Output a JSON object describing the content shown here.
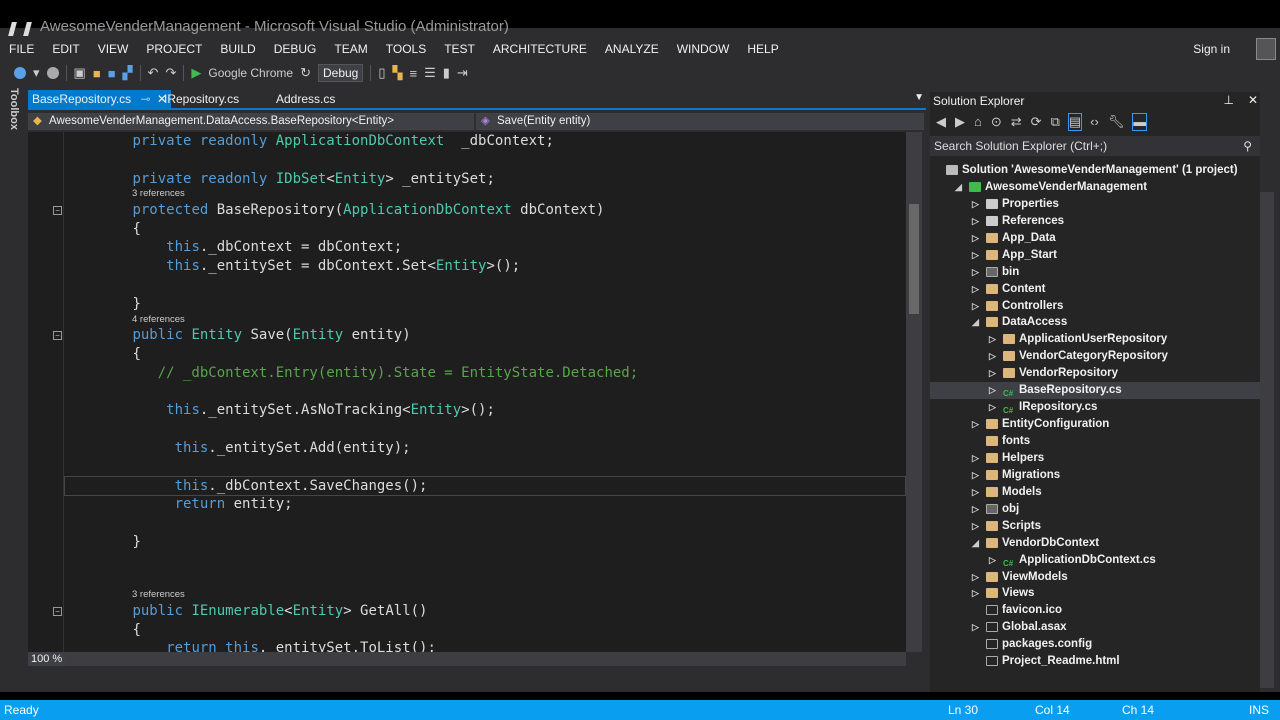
{
  "window": {
    "title": "AwesomeVenderManagement - Microsoft Visual Studio (Administrator)",
    "sign_in": "Sign in"
  },
  "menu": [
    "FILE",
    "EDIT",
    "VIEW",
    "PROJECT",
    "BUILD",
    "DEBUG",
    "TEAM",
    "TOOLS",
    "TEST",
    "ARCHITECTURE",
    "ANALYZE",
    "WINDOW",
    "HELP"
  ],
  "toolbar": {
    "browser": "Google Chrome",
    "config": "Debug"
  },
  "toolbox_label": "Toolbox",
  "tabs": [
    {
      "label": "BaseRepository.cs",
      "active": true
    },
    {
      "label": "IRepository.cs"
    },
    {
      "label": "Address.cs"
    }
  ],
  "navbar": {
    "type": "AwesomeVenderManagement.DataAccess.BaseRepository<Entity>",
    "member": "Save(Entity entity)"
  },
  "code": [
    {
      "i": 8,
      "t": [
        [
          "kw",
          "private readonly "
        ],
        [
          "ty",
          "ApplicationDbContext"
        ],
        [
          "",
          "  _dbContext;"
        ]
      ]
    },
    {
      "i": 0,
      "t": []
    },
    {
      "i": 8,
      "t": [
        [
          "kw",
          "private readonly "
        ],
        [
          "ty",
          "IDbSet"
        ],
        [
          "",
          "<"
        ],
        [
          "ty",
          "Entity"
        ],
        [
          "",
          "> _entitySet;"
        ]
      ]
    },
    {
      "ref": "3 references"
    },
    {
      "i": 8,
      "fold": true,
      "t": [
        [
          "kw",
          "protected "
        ],
        [
          "",
          "BaseRepository("
        ],
        [
          "ty",
          "ApplicationDbContext"
        ],
        [
          "",
          " dbContext)"
        ]
      ]
    },
    {
      "i": 8,
      "t": [
        [
          "",
          "{"
        ]
      ]
    },
    {
      "i": 12,
      "t": [
        [
          "kw",
          "this"
        ],
        [
          "",
          "._dbContext = dbContext;"
        ]
      ]
    },
    {
      "i": 12,
      "t": [
        [
          "kw",
          "this"
        ],
        [
          "",
          "._entitySet = dbContext.Set<"
        ],
        [
          "ty",
          "Entity"
        ],
        [
          "",
          ">();"
        ]
      ]
    },
    {
      "i": 0,
      "t": []
    },
    {
      "i": 8,
      "t": [
        [
          "",
          "}"
        ]
      ]
    },
    {
      "ref": "4 references"
    },
    {
      "i": 8,
      "fold": true,
      "t": [
        [
          "kw",
          "public "
        ],
        [
          "ty",
          "Entity"
        ],
        [
          "",
          " Save("
        ],
        [
          "ty",
          "Entity"
        ],
        [
          "",
          " entity)"
        ]
      ]
    },
    {
      "i": 8,
      "t": [
        [
          "",
          "{"
        ]
      ]
    },
    {
      "i": 11,
      "t": [
        [
          "cm",
          "// _dbContext.Entry(entity).State = EntityState.Detached;"
        ]
      ]
    },
    {
      "i": 0,
      "t": []
    },
    {
      "i": 12,
      "t": [
        [
          "kw",
          "this"
        ],
        [
          "",
          "._entitySet.AsNoTracking<"
        ],
        [
          "ty",
          "Entity"
        ],
        [
          "",
          ">();"
        ]
      ]
    },
    {
      "i": 0,
      "t": []
    },
    {
      "i": 13,
      "t": [
        [
          "kw",
          "this"
        ],
        [
          "",
          "._entitySet.Add(entity);"
        ]
      ]
    },
    {
      "i": 0,
      "t": []
    },
    {
      "i": 13,
      "cur": true,
      "t": [
        [
          "kw",
          "this"
        ],
        [
          "",
          "._dbContext.SaveChanges();"
        ]
      ]
    },
    {
      "i": 13,
      "t": [
        [
          "kw",
          "return"
        ],
        [
          "",
          " entity;"
        ]
      ]
    },
    {
      "i": 0,
      "t": []
    },
    {
      "i": 8,
      "t": [
        [
          "",
          "}"
        ]
      ]
    },
    {
      "i": 0,
      "t": []
    },
    {
      "i": 0,
      "t": []
    },
    {
      "ref": "3 references"
    },
    {
      "i": 8,
      "fold": true,
      "t": [
        [
          "kw",
          "public "
        ],
        [
          "ty",
          "IEnumerable"
        ],
        [
          "",
          "<"
        ],
        [
          "ty",
          "Entity"
        ],
        [
          "",
          "> GetAll()"
        ]
      ]
    },
    {
      "i": 8,
      "t": [
        [
          "",
          "{"
        ]
      ]
    },
    {
      "i": 12,
      "t": [
        [
          "kw",
          "return this"
        ],
        [
          "",
          "._entitySet.ToList();"
        ]
      ]
    }
  ],
  "editor": {
    "zoom": "100 %"
  },
  "solution_explorer": {
    "title": "Solution Explorer",
    "search_placeholder": "Search Solution Explorer (Ctrl+;)",
    "items": [
      {
        "l": 0,
        "label": "Solution 'AwesomeVenderManagement' (1 project)",
        "k": "sln"
      },
      {
        "l": 1,
        "label": "AwesomeVenderManagement",
        "k": "proj",
        "exp": true
      },
      {
        "l": 2,
        "label": "Properties",
        "k": "wrench",
        "col": true
      },
      {
        "l": 2,
        "label": "References",
        "k": "ref",
        "col": true
      },
      {
        "l": 2,
        "label": "App_Data",
        "k": "folder",
        "col": true
      },
      {
        "l": 2,
        "label": "App_Start",
        "k": "folder",
        "col": true
      },
      {
        "l": 2,
        "label": "bin",
        "k": "ghost",
        "col": true
      },
      {
        "l": 2,
        "label": "Content",
        "k": "folder",
        "col": true
      },
      {
        "l": 2,
        "label": "Controllers",
        "k": "folder",
        "col": true
      },
      {
        "l": 2,
        "label": "DataAccess",
        "k": "folder",
        "exp": true
      },
      {
        "l": 3,
        "label": "ApplicationUserRepository",
        "k": "folder",
        "col": true
      },
      {
        "l": 3,
        "label": "VendorCategoryRepository",
        "k": "folder",
        "col": true
      },
      {
        "l": 3,
        "label": "VendorRepository",
        "k": "folder",
        "col": true
      },
      {
        "l": 3,
        "label": "BaseRepository.cs",
        "k": "cs",
        "col": true,
        "sel": true
      },
      {
        "l": 3,
        "label": "IRepository.cs",
        "k": "cs",
        "col": true
      },
      {
        "l": 2,
        "label": "EntityConfiguration",
        "k": "folder",
        "col": true
      },
      {
        "l": 2,
        "label": "fonts",
        "k": "folder"
      },
      {
        "l": 2,
        "label": "Helpers",
        "k": "folder",
        "col": true
      },
      {
        "l": 2,
        "label": "Migrations",
        "k": "folder",
        "col": true
      },
      {
        "l": 2,
        "label": "Models",
        "k": "folder",
        "col": true
      },
      {
        "l": 2,
        "label": "obj",
        "k": "ghost",
        "col": true
      },
      {
        "l": 2,
        "label": "Scripts",
        "k": "folder",
        "col": true
      },
      {
        "l": 2,
        "label": "VendorDbContext",
        "k": "folder",
        "exp": true
      },
      {
        "l": 3,
        "label": "ApplicationDbContext.cs",
        "k": "cs",
        "col": true
      },
      {
        "l": 2,
        "label": "ViewModels",
        "k": "folder",
        "col": true
      },
      {
        "l": 2,
        "label": "Views",
        "k": "folder",
        "col": true
      },
      {
        "l": 2,
        "label": "favicon.ico",
        "k": "file"
      },
      {
        "l": 2,
        "label": "Global.asax",
        "k": "file",
        "col": true
      },
      {
        "l": 2,
        "label": "packages.config",
        "k": "file"
      },
      {
        "l": 2,
        "label": "Project_Readme.html",
        "k": "file"
      }
    ]
  },
  "status": {
    "text": "Ready",
    "line": "Ln 30",
    "col": "Col 14",
    "ch": "Ch 14",
    "mode": "INS"
  },
  "colors": {
    "accent": "#007acc",
    "status": "#0a9ef0",
    "keyword": "#569cd6",
    "type": "#4ec9b0",
    "comment": "#57a64a"
  }
}
